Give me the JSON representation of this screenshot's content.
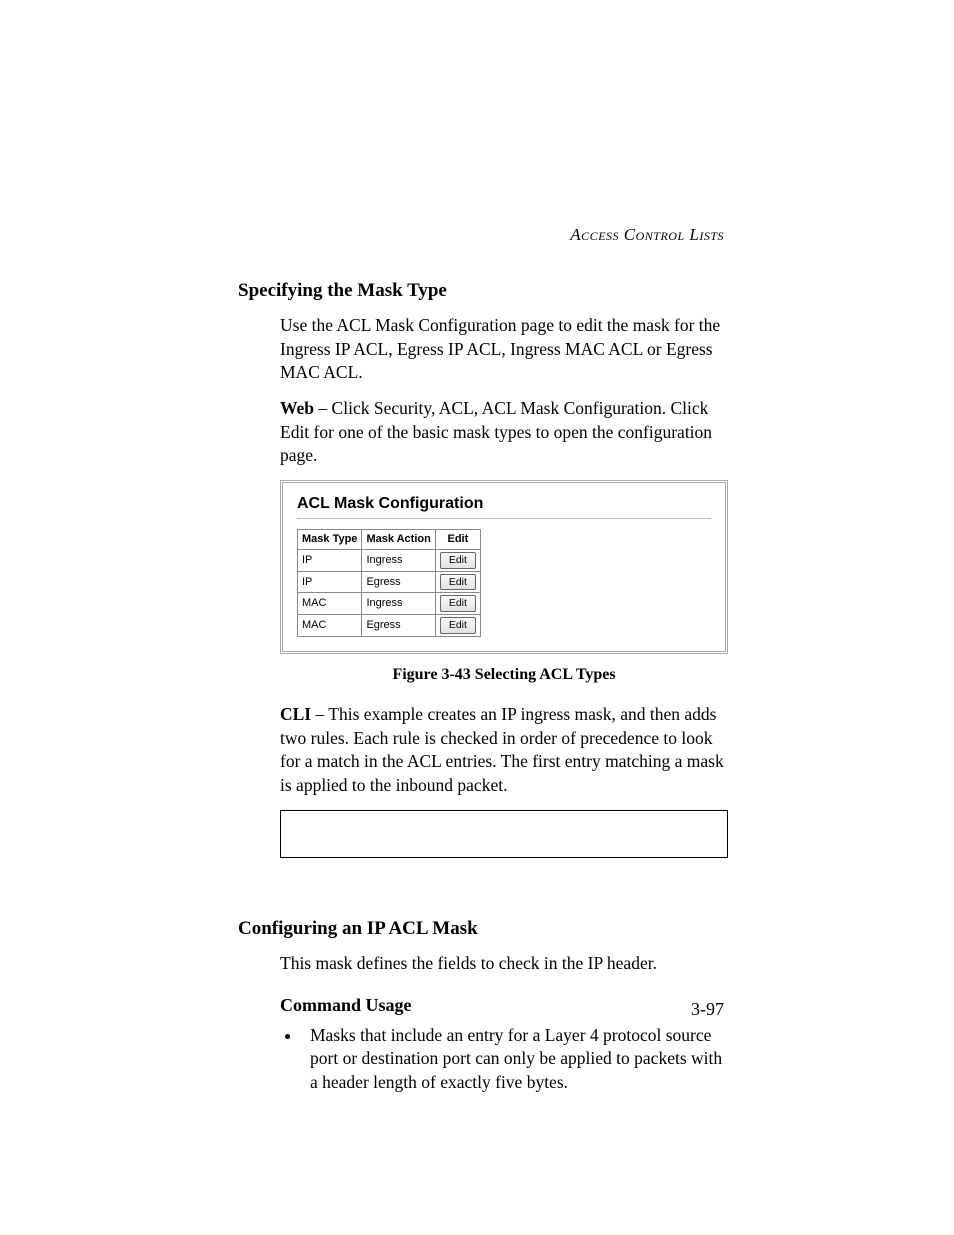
{
  "running_head": "Access Control Lists",
  "section1_title": "Specifying the Mask Type",
  "intro_p1": "Use the ACL Mask Configuration page to edit the mask for the Ingress IP ACL, Egress IP ACL, Ingress MAC ACL or Egress MAC ACL.",
  "web_label": "Web",
  "web_text": " – Click Security, ACL, ACL Mask Configuration. Click Edit for one of the basic mask types to open the configuration page.",
  "screenshot": {
    "title": "ACL Mask Configuration",
    "headers": {
      "col1": "Mask Type",
      "col2": "Mask Action",
      "col3": "Edit"
    },
    "rows": [
      {
        "type": "IP",
        "action": "Ingress",
        "btn": "Edit"
      },
      {
        "type": "IP",
        "action": "Egress",
        "btn": "Edit"
      },
      {
        "type": "MAC",
        "action": "Ingress",
        "btn": "Edit"
      },
      {
        "type": "MAC",
        "action": "Egress",
        "btn": "Edit"
      }
    ]
  },
  "figure_caption": "Figure 3-43  Selecting ACL Types",
  "cli_label": "CLI",
  "cli_text": " – This example creates an IP ingress mask, and then adds two rules. Each rule is checked in order of precedence to look for a match in the ACL entries. The first entry matching a mask is applied to the inbound packet.",
  "section2_title": "Configuring an IP ACL Mask",
  "section2_intro": "This mask defines the fields to check in the IP header.",
  "cmd_usage_title": "Command Usage",
  "cmd_usage_bullet": "Masks that include an entry for a Layer 4 protocol source port or destination port can only be applied to packets with a header length of exactly five bytes.",
  "page_number": "3-97"
}
